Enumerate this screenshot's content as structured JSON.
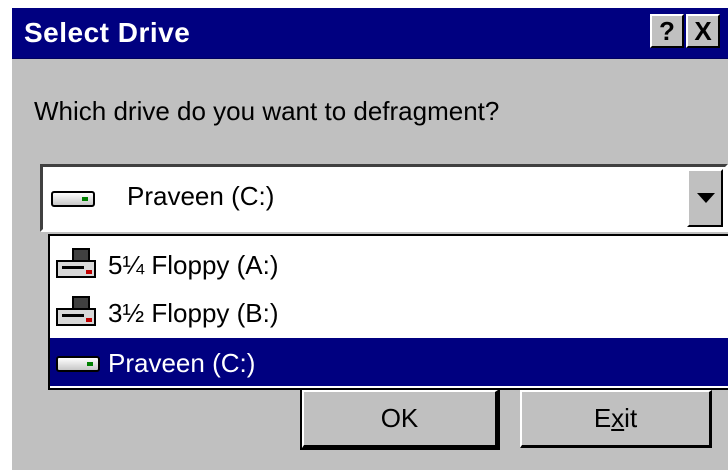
{
  "window": {
    "title": "Select Drive",
    "help_label": "?",
    "close_label": "X"
  },
  "prompt": "Which drive do you want to defragment?",
  "combo": {
    "selected": "Praveen (C:)"
  },
  "dropdown": {
    "items": [
      {
        "label": "5¼ Floppy (A:)",
        "icon": "floppy-drive-icon"
      },
      {
        "label": "3½ Floppy (B:)",
        "icon": "floppy-drive-icon"
      },
      {
        "label": "Praveen (C:)",
        "icon": "hard-drive-icon",
        "selected": true
      }
    ]
  },
  "buttons": {
    "ok": "OK",
    "exit_pre": "E",
    "exit_underlined": "x",
    "exit_post": "it"
  },
  "colors": {
    "title_bar": "#000080",
    "selection": "#000080",
    "face": "#c0c0c0"
  }
}
